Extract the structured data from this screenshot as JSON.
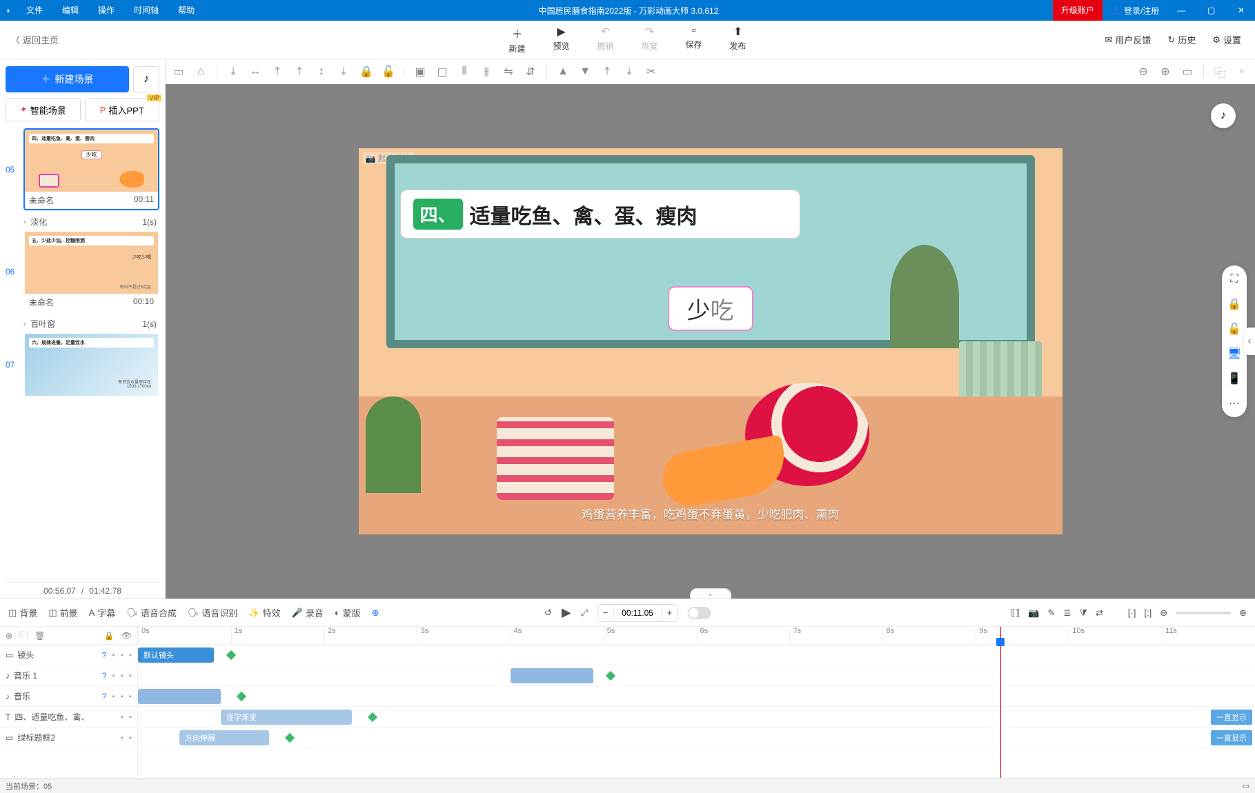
{
  "titlebar": {
    "menus": [
      "文件",
      "编辑",
      "操作",
      "时间轴",
      "帮助"
    ],
    "title": "中国居民膳食指南2022版 - 万彩动画大师 3.0.612",
    "upgrade": "升级账户",
    "login": "登录/注册"
  },
  "secondbar": {
    "back": "返回主页",
    "tools": [
      {
        "label": "新建",
        "icon": "＋"
      },
      {
        "label": "预览",
        "icon": "▶"
      },
      {
        "label": "撤销",
        "icon": "↶",
        "disabled": true
      },
      {
        "label": "恢复",
        "icon": "↷",
        "disabled": true
      },
      {
        "label": "保存",
        "icon": "▫"
      },
      {
        "label": "发布",
        "icon": "⬆"
      }
    ],
    "right": [
      {
        "label": "用户反馈",
        "icon": "✉"
      },
      {
        "label": "历史",
        "icon": "↻"
      },
      {
        "label": "设置",
        "icon": "⚙"
      }
    ]
  },
  "leftpanel": {
    "newscene": "新建场景",
    "smartscene": "智能场景",
    "insertppt": "插入PPT",
    "vip": "VIP",
    "scenes": [
      {
        "num": "05",
        "name": "未命名",
        "dur": "00:11",
        "mini_title": "四、适量吃鱼、禽、蛋、瘦肉",
        "mini_sub": "少吃",
        "trans": "淡化",
        "trans_dur": "1(s)"
      },
      {
        "num": "06",
        "name": "未命名",
        "dur": "00:10",
        "mini_title": "五、少盐少油，控糖限酒",
        "mini_sub": "少吃少喝",
        "mini_note": "每日不超过5克盐",
        "trans": "百叶窗",
        "trans_dur": "1(s)"
      },
      {
        "num": "07",
        "name": "",
        "dur": "",
        "mini_title": "六、规律进餐，足量饮水",
        "mini_sub": "",
        "mini_note": "每日饮水量保持在\n1500-1700ml"
      }
    ],
    "current": "00:56.07",
    "total": "01:42.78"
  },
  "canvas": {
    "camera_label": "默认镜头",
    "title_num": "四、",
    "title_text": "适量吃鱼、禽、蛋、瘦肉",
    "sub_a": "少",
    "sub_b": "吃",
    "subtitle": "鸡蛋营养丰富，吃鸡蛋不弃蛋黄，少吃肥肉、熏肉"
  },
  "timeline": {
    "tabs": [
      "背景",
      "前景",
      "字幕",
      "语音合成",
      "语音识别",
      "特效",
      "录音",
      "蒙版"
    ],
    "time": "00:11.05",
    "ticks": [
      "0s",
      "1s",
      "2s",
      "3s",
      "4s",
      "5s",
      "6s",
      "7s",
      "8s",
      "9s",
      "10s",
      "11s"
    ],
    "tracks": [
      {
        "name": "镜头",
        "icon": "▭",
        "clip": "默认镜头"
      },
      {
        "name": "音乐 1",
        "icon": "♪"
      },
      {
        "name": "音乐",
        "icon": "♪"
      },
      {
        "name": "四、适量吃鱼、禽、",
        "icon": "T",
        "clip": "逐字渐变",
        "end": "一直显示"
      },
      {
        "name": "绿标题框2",
        "icon": "▭",
        "clip": "方向伸展",
        "end": "一直显示"
      }
    ]
  },
  "statusbar": {
    "text": "当前场景：05"
  }
}
